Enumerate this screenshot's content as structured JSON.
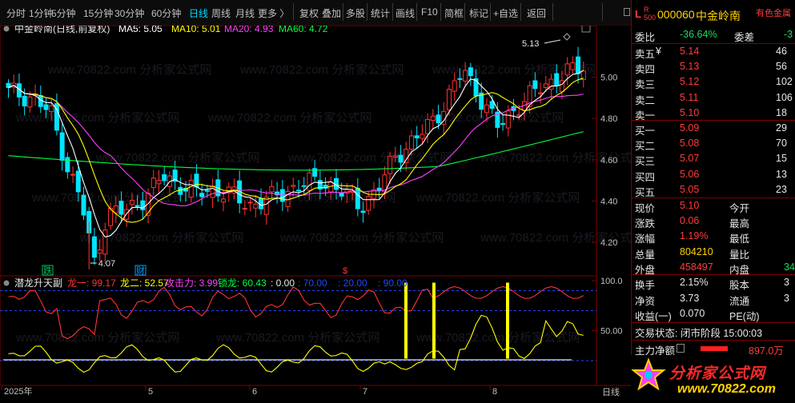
{
  "toolbar": {
    "items": [
      "分时",
      "1分钟",
      "5分钟",
      "15分钟",
      "30分钟",
      "60分钟",
      "日线",
      "周线",
      "月线",
      "更多 〉",
      "复权",
      "叠加",
      "多股",
      "统计",
      "画线",
      "F10",
      "简框",
      "标记",
      "+自选",
      "返回"
    ],
    "active": "日线"
  },
  "main_chart": {
    "title": "中金岭南(日线,前复权)",
    "ma": [
      {
        "label": "MA5: 5.05",
        "color": "#ffffff"
      },
      {
        "label": "MA10: 5.01",
        "color": "#ffff00"
      },
      {
        "label": "MA20: 4.93",
        "color": "#ff40ff"
      },
      {
        "label": "MA60: 4.72",
        "color": "#00ff40"
      }
    ],
    "price_axis": [
      "5.00",
      "4.80",
      "4.60",
      "4.40",
      "4.20"
    ],
    "high_label": "5.13",
    "low_label": "4.07",
    "markers": [
      "跌",
      "财",
      "$"
    ],
    "watermark": "www.70822.com 分析家公式网"
  },
  "indicator": {
    "name": "潜龙升天副",
    "values": [
      {
        "label": "龙一: 99.17",
        "color": "#ff3333"
      },
      {
        "label": "龙二: 52.57",
        "color": "#ffff00"
      },
      {
        "label": "攻击力: 3.99",
        "color": "#ff40ff"
      },
      {
        "label": "锁龙: 60.43",
        "color": "#00ff40"
      },
      {
        "label": ": 0.00",
        "color": "#e6e6e6"
      },
      {
        "label": ": 70.00",
        "color": "#2244ff"
      },
      {
        "label": ": 20.00",
        "color": "#2244ff"
      },
      {
        "label": ": 90.00",
        "color": "#2244ff"
      }
    ],
    "axis": [
      "100.0",
      "50.00"
    ]
  },
  "date_axis": {
    "labels": [
      "2025年",
      "5",
      "6",
      "7",
      "8"
    ],
    "period": "日线"
  },
  "quote": {
    "code": "000060",
    "name": "中金岭南",
    "sector": "有色金属",
    "wei_bi": "-36.64%",
    "wei_cha_label": "委差",
    "wei_cha": "-3",
    "asks": [
      {
        "label": "卖五",
        "price": "5.14",
        "vol": "46"
      },
      {
        "label": "卖四",
        "price": "5.13",
        "vol": "56"
      },
      {
        "label": "卖三",
        "price": "5.12",
        "vol": "102"
      },
      {
        "label": "卖二",
        "price": "5.11",
        "vol": "106"
      },
      {
        "label": "卖一",
        "price": "5.10",
        "vol": "18"
      }
    ],
    "bids": [
      {
        "label": "买一",
        "price": "5.09",
        "vol": "29"
      },
      {
        "label": "买二",
        "price": "5.08",
        "vol": "70"
      },
      {
        "label": "买三",
        "price": "5.07",
        "vol": "15"
      },
      {
        "label": "买四",
        "price": "5.06",
        "vol": "13"
      },
      {
        "label": "买五",
        "price": "5.05",
        "vol": "23"
      }
    ],
    "stats": [
      {
        "l1": "现价",
        "v1": "5.10",
        "c1": "red",
        "l2": "今开",
        "v2": ""
      },
      {
        "l1": "涨跌",
        "v1": "0.06",
        "c1": "red",
        "l2": "最高",
        "v2": ""
      },
      {
        "l1": "涨幅",
        "v1": "1.19%",
        "c1": "red",
        "l2": "最低",
        "v2": ""
      },
      {
        "l1": "总量",
        "v1": "804210",
        "c1": "yellow",
        "l2": "量比",
        "v2": ""
      },
      {
        "l1": "外盘",
        "v1": "458497",
        "c1": "red",
        "l2": "内盘",
        "v2": "34"
      }
    ],
    "stats2": [
      {
        "l1": "换手",
        "v1": "2.15%",
        "l2": "股本",
        "v2": "3"
      },
      {
        "l1": "净资",
        "v1": "3.73",
        "l2": "流通",
        "v2": "3"
      },
      {
        "l1": "收益(一)",
        "v1": "0.070",
        "l2": "PE(动)",
        "v2": ""
      }
    ],
    "trade_status": "交易状态: 闭市阶段 15:00:03",
    "main_flow_label": "主力净额",
    "main_flow_value": "897.0万"
  },
  "logo": {
    "text": "分析家公式网",
    "url": "www.70822.com"
  }
}
